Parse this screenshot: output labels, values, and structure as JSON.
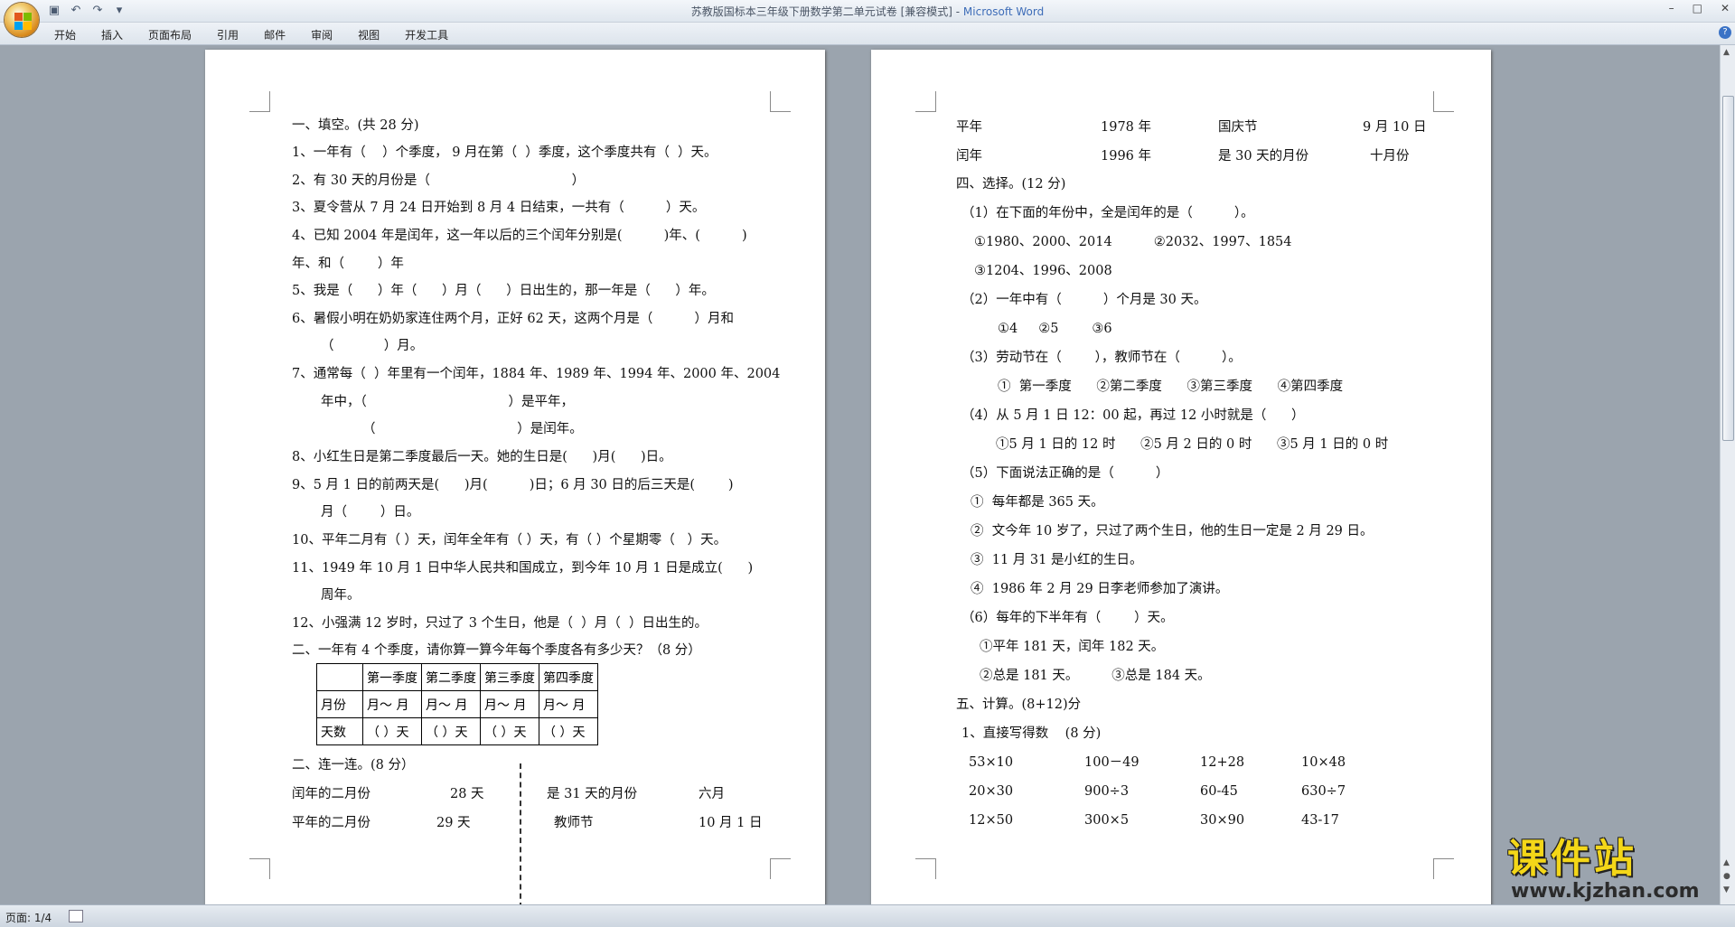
{
  "window": {
    "title": "苏教版国标本三年级下册数学第二单元试卷 [兼容模式] - ",
    "app_name": "Microsoft Word",
    "controls": [
      "–",
      "□",
      "✕"
    ]
  },
  "ribbon": {
    "tabs": [
      "开始",
      "插入",
      "页面布局",
      "引用",
      "邮件",
      "审阅",
      "视图",
      "开发工具"
    ],
    "help": "?"
  },
  "qat": [
    "save-icon",
    "undo-icon",
    "redo-icon",
    "customize-icon"
  ],
  "page1": {
    "lines": [
      "一、填空。(共 28 分)",
      "1、一年有（    ）个季度， 9 月在第（  ）季度，这个季度共有（  ）天。",
      "2、有 30 天的月份是（                                  ）",
      "3、夏令营从 7 月 24 日开始到 8 月 4 日结束，一共有（          ）天。",
      "4、已知 2004 年是闰年，这一年以后的三个闰年分别是(          )年、(          )",
      "年、和（        ）年",
      "5、我是（      ）年（      ）月（      ）日出生的，那一年是（      ）年。",
      "6、暑假小明在奶奶家连住两个月，正好 62 天，这两个月是（          ）月和",
      "（            ）月。",
      "7、通常每（  ）年里有一个闰年，1884 年、1989 年、1994 年、2000 年、2004",
      "年中，（                                  ）是平年，",
      "（                                  ）是闰年。",
      "8、小红生日是第二季度最后一天。她的生日是(      )月(      )日。",
      "9、5 月 1 日的前两天是(      )月(          )日；6 月 30 日的后三天是(        )",
      "月（        ）日。",
      "10、平年二月有（ ）天，闰年全年有（ ）天，有（ ）个星期零（   ）天。",
      "11、1949 年 10 月 1 日中华人民共和国成立，到今年 10 月 1 日是成立(      )",
      "周年。",
      "12、小强满 12 岁时，只过了 3 个生日，他是（  ）月（  ）日出生的。",
      "二、一年有 4 个季度，请你算一算今年每个季度各有多少天？（8 分）"
    ],
    "table": {
      "header": [
        "",
        "第一季度",
        "第二季度",
        "第三季度",
        "第四季度"
      ],
      "rows": [
        [
          "月份",
          "月～  月",
          "月～  月",
          "月～  月",
          "月～  月"
        ],
        [
          "天数",
          "（    ）天",
          "（    ）天",
          "（    ）天",
          "（    ）天"
        ]
      ]
    },
    "match_heading": "二、连一连。(8 分）",
    "match_left": [
      [
        "闰年的二月份",
        "28 天"
      ],
      [
        "平年的二月份",
        "29 天"
      ]
    ],
    "match_right": [
      [
        "是 31 天的月份",
        "六月"
      ],
      [
        "教师节",
        "10 月 1 日"
      ]
    ]
  },
  "page2": {
    "match_rows": [
      [
        "平年",
        "1978 年",
        "国庆节",
        "9 月 10 日"
      ],
      [
        "闰年",
        "1996 年",
        "是 30 天的月份",
        "十月份"
      ]
    ],
    "lines": [
      "四、选择。(12 分)",
      "（1）在下面的年份中，全是闰年的是（          ）。",
      "①1980、2000、2014          ②2032、1997、1854",
      "③1204、1996、2008",
      "（2）一年中有（          ）个月是 30 天。",
      "①4     ②5        ③6",
      "（3）劳动节在（        ），教师节在（          ）。",
      "①  第一季度      ②第二季度      ③第三季度      ④第四季度",
      "（4）从 5 月 1 日 12：00 起，再过 12 小时就是（      ）",
      "①5 月 1 日的 12 时      ②5 月 2 日的 0 时      ③5 月 1 日的 0 时",
      "（5）下面说法正确的是（          ）",
      "①  每年都是 365 天。",
      "②  文今年 10 岁了，只过了两个生日，他的生日一定是 2 月 29 日。",
      "③  11 月 31 是小红的生日。",
      "④  1986 年 2 月 29 日李老师参加了演讲。",
      "（6）每年的下半年有（        ）天。",
      "①平年 181 天，闰年 182 天。",
      "②总是 181 天。        ③总是 184 天。",
      "五、计算。(8+12)分",
      "1、直接写得数    (8 分)"
    ],
    "calc_rows": [
      [
        "53×10",
        "100－49",
        "12+28",
        "10×48"
      ],
      [
        "20×30",
        "900÷3",
        "60-45",
        "630÷7"
      ],
      [
        "12×50",
        "300×5",
        "30×90",
        "43-17"
      ]
    ]
  },
  "status": {
    "page": "页面: 1/4"
  },
  "watermark": {
    "title": "课件站",
    "url": "www.kjzhan.com"
  }
}
